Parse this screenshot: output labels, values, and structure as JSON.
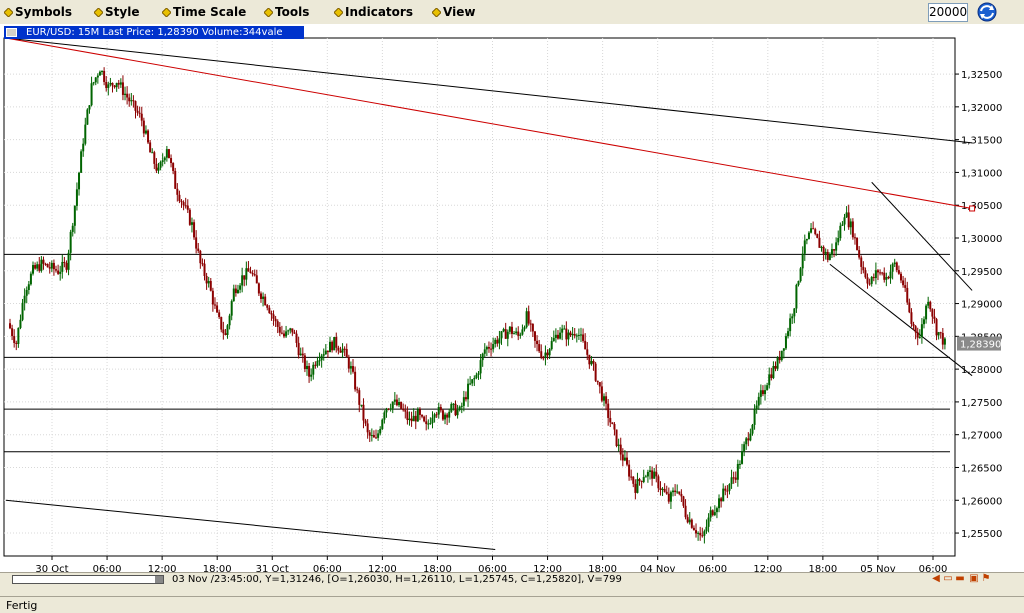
{
  "menu": {
    "items": [
      {
        "label": "Symbols",
        "name": "menu-symbols"
      },
      {
        "label": "Style",
        "name": "menu-style"
      },
      {
        "label": "Time Scale",
        "name": "menu-time-scale"
      },
      {
        "label": "Tools",
        "name": "menu-tools"
      },
      {
        "label": "Indicators",
        "name": "menu-indicators"
      },
      {
        "label": "View",
        "name": "menu-view"
      }
    ],
    "zoom_value": "20000"
  },
  "chart_window": {
    "title": "EUR/USD: 15M Last Price: 1,28390 Volume:344vale"
  },
  "chart_data": {
    "type": "candlestick",
    "symbol": "EUR/USD",
    "timeframe": "15M",
    "last_price_label": "1,28390",
    "y_ticks": [
      "1,32500",
      "1,32000",
      "1,31500",
      "1,31000",
      "1,30500",
      "1,30000",
      "1,29500",
      "1,29000",
      "1,28500",
      "1,28000",
      "1,27500",
      "1,27000",
      "1,26500",
      "1,26000",
      "1,25500"
    ],
    "y_values": [
      1.325,
      1.32,
      1.315,
      1.31,
      1.305,
      1.3,
      1.295,
      1.29,
      1.285,
      1.28,
      1.275,
      1.27,
      1.265,
      1.26,
      1.255
    ],
    "ylim": [
      1.2515,
      1.3305
    ],
    "x_ticks": [
      "30 Oct",
      "06:00",
      "12:00",
      "18:00",
      "31 Oct",
      "06:00",
      "12:00",
      "18:00",
      "06:00",
      "12:00",
      "18:00",
      "04 Nov",
      "06:00",
      "12:00",
      "18:00",
      "05 Nov",
      "06:00"
    ],
    "price_path": [
      [
        0,
        1.287
      ],
      [
        1,
        1.284
      ],
      [
        2,
        1.292
      ],
      [
        3,
        1.295
      ],
      [
        4,
        1.296
      ],
      [
        5,
        1.2955
      ],
      [
        6,
        1.295
      ],
      [
        7,
        1.296
      ],
      [
        8,
        1.305
      ],
      [
        9,
        1.315
      ],
      [
        10,
        1.323
      ],
      [
        11,
        1.326
      ],
      [
        12,
        1.323
      ],
      [
        13,
        1.324
      ],
      [
        14,
        1.322
      ],
      [
        15,
        1.32
      ],
      [
        16,
        1.318
      ],
      [
        17,
        1.313
      ],
      [
        18,
        1.31
      ],
      [
        19,
        1.314
      ],
      [
        20,
        1.308
      ],
      [
        21,
        1.305
      ],
      [
        22,
        1.302
      ],
      [
        23,
        1.296
      ],
      [
        24,
        1.293
      ],
      [
        25,
        1.288
      ],
      [
        26,
        1.285
      ],
      [
        27,
        1.292
      ],
      [
        28,
        1.294
      ],
      [
        29,
        1.295
      ],
      [
        30,
        1.292
      ],
      [
        31,
        1.29
      ],
      [
        32,
        1.287
      ],
      [
        33,
        1.285
      ],
      [
        34,
        1.286
      ],
      [
        35,
        1.282
      ],
      [
        36,
        1.279
      ],
      [
        37,
        1.282
      ],
      [
        38,
        1.283
      ],
      [
        39,
        1.284
      ],
      [
        40,
        1.283
      ],
      [
        41,
        1.28
      ],
      [
        42,
        1.275
      ],
      [
        43,
        1.27
      ],
      [
        44,
        1.269
      ],
      [
        45,
        1.274
      ],
      [
        46,
        1.275
      ],
      [
        47,
        1.274
      ],
      [
        48,
        1.272
      ],
      [
        49,
        1.273
      ],
      [
        50,
        1.271
      ],
      [
        51,
        1.274
      ],
      [
        52,
        1.273
      ],
      [
        53,
        1.274
      ],
      [
        54,
        1.2735
      ],
      [
        55,
        1.277
      ],
      [
        56,
        1.279
      ],
      [
        57,
        1.283
      ],
      [
        58,
        1.284
      ],
      [
        59,
        1.285
      ],
      [
        60,
        1.286
      ],
      [
        61,
        1.285
      ],
      [
        62,
        1.288
      ],
      [
        63,
        1.284
      ],
      [
        64,
        1.282
      ],
      [
        65,
        1.284
      ],
      [
        66,
        1.286
      ],
      [
        67,
        1.285
      ],
      [
        68,
        1.286
      ],
      [
        69,
        1.283
      ],
      [
        70,
        1.28
      ],
      [
        71,
        1.276
      ],
      [
        72,
        1.272
      ],
      [
        73,
        1.268
      ],
      [
        74,
        1.265
      ],
      [
        75,
        1.262
      ],
      [
        76,
        1.264
      ],
      [
        77,
        1.264
      ],
      [
        78,
        1.262
      ],
      [
        79,
        1.26
      ],
      [
        80,
        1.262
      ],
      [
        81,
        1.258
      ],
      [
        82,
        1.256
      ],
      [
        83,
        1.254
      ],
      [
        84,
        1.258
      ],
      [
        85,
        1.26
      ],
      [
        86,
        1.262
      ],
      [
        87,
        1.264
      ],
      [
        88,
        1.268
      ],
      [
        89,
        1.272
      ],
      [
        90,
        1.276
      ],
      [
        91,
        1.279
      ],
      [
        92,
        1.281
      ],
      [
        93,
        1.285
      ],
      [
        94,
        1.29
      ],
      [
        95,
        1.298
      ],
      [
        96,
        1.301
      ],
      [
        97,
        1.299
      ],
      [
        98,
        1.297
      ],
      [
        99,
        1.299
      ],
      [
        100,
        1.304
      ],
      [
        101,
        1.301
      ],
      [
        102,
        1.296
      ],
      [
        103,
        1.293
      ],
      [
        104,
        1.295
      ],
      [
        105,
        1.294
      ],
      [
        106,
        1.296
      ],
      [
        107,
        1.293
      ],
      [
        108,
        1.287
      ],
      [
        109,
        1.285
      ],
      [
        110,
        1.291
      ],
      [
        111,
        1.286
      ],
      [
        112,
        1.2839
      ]
    ],
    "horizontal_levels": [
      1.2975,
      1.2818,
      1.2739,
      1.2674
    ],
    "trendlines": [
      {
        "color": "#000000",
        "from": [
          -0.5,
          1.3305
        ],
        "to": [
          115,
          1.3145
        ]
      },
      {
        "color": "#cc0000",
        "from": [
          -0.5,
          1.3305
        ],
        "to": [
          115,
          1.3045
        ]
      },
      {
        "color": "#000000",
        "from": [
          -0.5,
          1.26
        ],
        "to": [
          58,
          1.2525
        ]
      },
      {
        "color": "#000000",
        "from": [
          103,
          1.3085
        ],
        "to": [
          115,
          1.292
        ]
      },
      {
        "color": "#000000",
        "from": [
          98,
          1.296
        ],
        "to": [
          115,
          1.279
        ]
      }
    ]
  },
  "status": {
    "info_line": "03 Nov /23:45:00, Y=1,31246, [O=1,26030, H=1,26110, L=1,25745, C=1,25820], V=799",
    "bottom_text": "Fertig"
  }
}
